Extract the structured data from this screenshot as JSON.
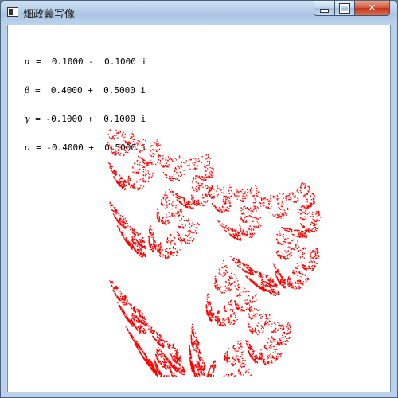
{
  "window": {
    "title": "畑政義写像"
  },
  "controls": {
    "minimize": "",
    "maximize": "",
    "close": "✕"
  },
  "params": [
    {
      "symbol": "α",
      "text": " =  0.1000 -  0.1000 i"
    },
    {
      "symbol": "β",
      "text": " =  0.4000 +  0.5000 i"
    },
    {
      "symbol": "γ",
      "text": " = -0.1000 +  0.1000 i"
    },
    {
      "symbol": "σ",
      "text": " = -0.4000 +  0.5000 i"
    }
  ],
  "fractal_color": "#ff0000"
}
